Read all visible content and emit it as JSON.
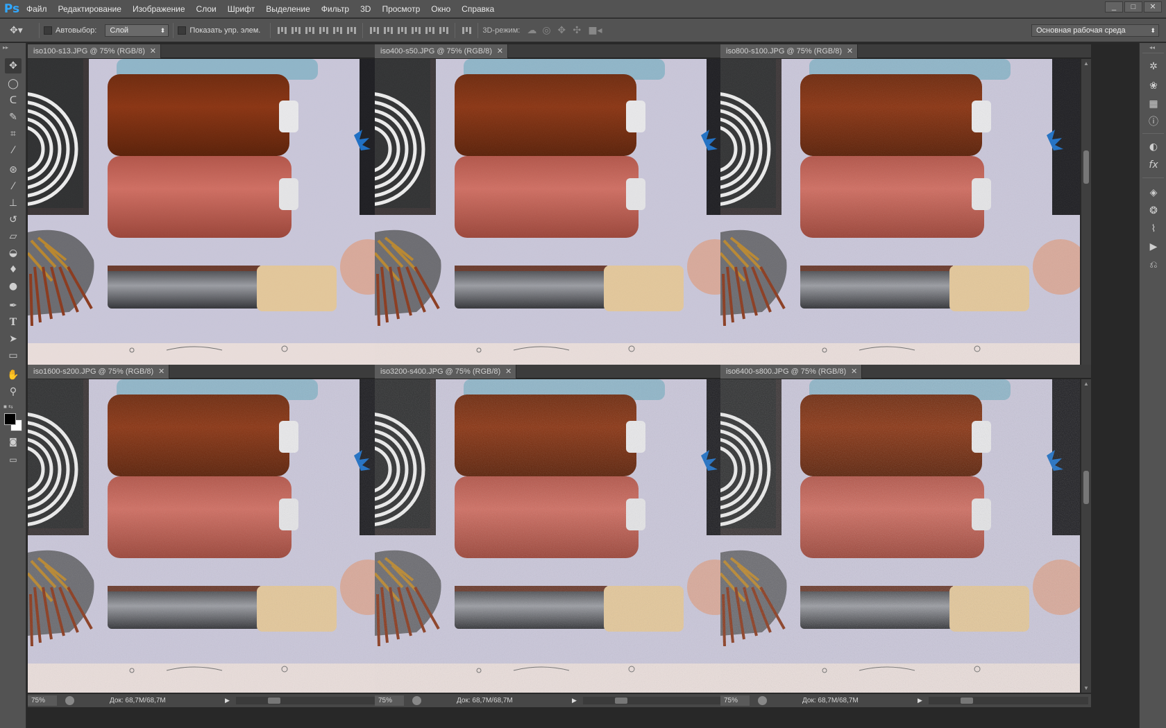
{
  "app": {
    "logo": "Ps"
  },
  "menu": [
    "Файл",
    "Редактирование",
    "Изображение",
    "Слои",
    "Шрифт",
    "Выделение",
    "Фильтр",
    "3D",
    "Просмотр",
    "Окно",
    "Справка"
  ],
  "window_controls": [
    "_",
    "□",
    "✕"
  ],
  "options": {
    "autoselect_label": "Автовыбор:",
    "autoselect_value": "Слой",
    "show_transform_label": "Показать упр. элем.",
    "mode3d_label": "3D-режим:",
    "workspace_value": "Основная рабочая среда"
  },
  "documents": [
    {
      "tab": "iso100-s13.JPG @ 75% (RGB/8)",
      "zoom": "75%",
      "status": "Док: 68,7M/68,7M"
    },
    {
      "tab": "iso400-s50.JPG @ 75% (RGB/8)",
      "zoom": "75%",
      "status": "Док: 68,7M/68,7M"
    },
    {
      "tab": "iso800-s100.JPG @ 75% (RGB/8)",
      "zoom": "75%",
      "status": "Док: 68,7M/68,7M"
    },
    {
      "tab": "iso1600-s200.JPG @ 75% (RGB/8)",
      "zoom": "75%",
      "status": "Док: 68,7M/68,7M"
    },
    {
      "tab": "iso3200-s400.JPG @ 75% (RGB/8)",
      "zoom": "75%",
      "status": "Док: 68,7M/68,7M"
    },
    {
      "tab": "iso6400-s800.JPG @ 75% (RGB/8)",
      "zoom": "75%",
      "status": "Док: 68,7M/68,7M"
    }
  ],
  "colors": {
    "spool_dark": "#8a3412",
    "spool_light": "#cf6e62",
    "background_paper": "#c9c6d9",
    "brush_bristles": "#e3c79a",
    "metal": "#5f6166",
    "spool_top": "#8fb5c8"
  },
  "tools": [
    "move-tool",
    "marquee-tool",
    "lasso-tool",
    "quick-select-tool",
    "crop-tool",
    "eyedropper-tool",
    "healing-brush-tool",
    "brush-tool",
    "clone-stamp-tool",
    "history-brush-tool",
    "eraser-tool",
    "paint-bucket-tool",
    "blur-tool",
    "dodge-tool",
    "pen-tool",
    "type-tool",
    "path-select-tool",
    "rectangle-tool",
    "hand-tool",
    "zoom-tool"
  ],
  "panel_icons": [
    "3d-icon",
    "brush-presets-icon",
    "swatches-icon",
    "info-icon",
    "adjustments-icon",
    "styles-icon",
    "layers-icon",
    "channels-icon",
    "paths-icon",
    "actions-icon",
    "history-icon"
  ]
}
